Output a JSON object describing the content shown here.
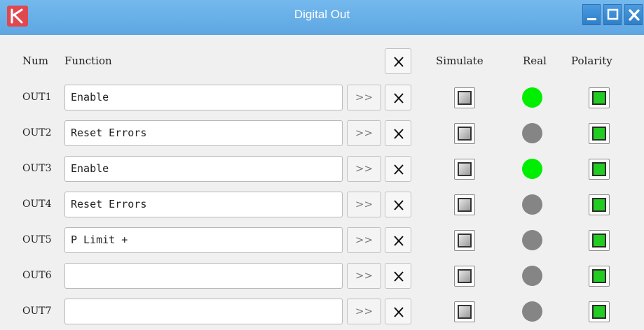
{
  "window": {
    "title": "Digital Out",
    "controls": [
      "minimize-icon",
      "maximize-icon",
      "close-icon"
    ]
  },
  "header": {
    "num": "Num",
    "function": "Function",
    "simulate": "Simulate",
    "real": "Real",
    "polarity": "Polarity"
  },
  "row_button": {
    "arrow_label": ">>"
  },
  "colors": {
    "real_on": "#00ee00",
    "real_off": "#858585",
    "polarity_on": "#22cc22",
    "titlebar": "#66ace6"
  },
  "rows": [
    {
      "label": "OUT1",
      "function": "Enable",
      "real_on": true,
      "polarity_on": true
    },
    {
      "label": "OUT2",
      "function": "Reset Errors",
      "real_on": false,
      "polarity_on": true
    },
    {
      "label": "OUT3",
      "function": "Enable",
      "real_on": true,
      "polarity_on": true
    },
    {
      "label": "OUT4",
      "function": "Reset Errors",
      "real_on": false,
      "polarity_on": true
    },
    {
      "label": "OUT5",
      "function": "P Limit +",
      "real_on": false,
      "polarity_on": true
    },
    {
      "label": "OUT6",
      "function": "",
      "real_on": false,
      "polarity_on": true
    },
    {
      "label": "OUT7",
      "function": "",
      "real_on": false,
      "polarity_on": true
    }
  ]
}
